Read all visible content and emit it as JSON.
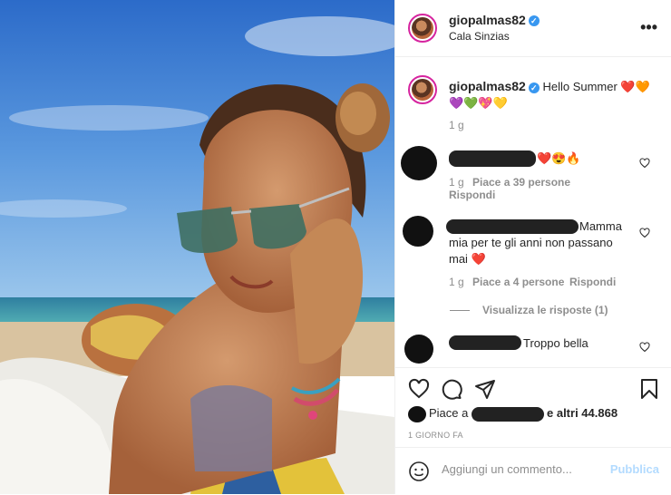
{
  "header": {
    "username": "giopalmas82",
    "location": "Cala Sinzias",
    "more_glyph": "•••"
  },
  "caption": {
    "username": "giopalmas82",
    "text": "Hello Summer ❤️🧡",
    "emojis": "💜💚💖💛",
    "age": "1 g"
  },
  "comments": [
    {
      "text_after_redaction": "❤️😍🔥",
      "age": "1 g",
      "likes": "Piace a 39 persone",
      "reply": "Rispondi"
    },
    {
      "text_after_redaction": "Mamma",
      "text_rest": "mia per te gli anni non passano mai ❤️",
      "age": "1 g",
      "likes": "Piace a 4 persone",
      "reply": "Rispondi",
      "view_replies": "Visualizza le risposte (1)"
    },
    {
      "text_after_redaction": "Troppo bella"
    }
  ],
  "actions": {
    "like_icon": "heart-outline-icon",
    "comment_icon": "speech-bubble-icon",
    "share_icon": "paper-plane-icon",
    "save_icon": "bookmark-icon"
  },
  "likes_line": {
    "prefix": "Piace a",
    "suffix": "e altri 44.868"
  },
  "time_ago": "1 GIORNO FA",
  "add_comment": {
    "placeholder": "Aggiungi un commento...",
    "publish": "Pubblica",
    "emoji_icon": "smiley-icon"
  }
}
